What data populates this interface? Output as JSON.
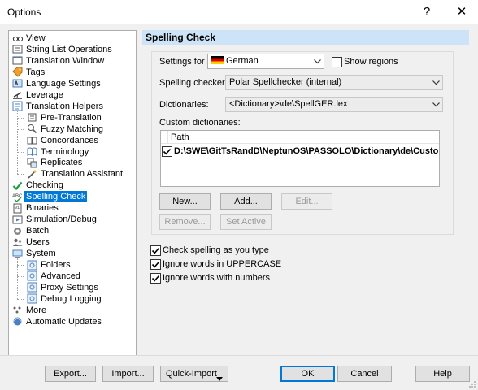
{
  "window": {
    "title": "Options",
    "help_glyph": "?",
    "close_glyph": "✕"
  },
  "tree": {
    "items": [
      {
        "label": "View",
        "icon": "view-icon"
      },
      {
        "label": "String List Operations",
        "icon": "string-list-icon"
      },
      {
        "label": "Translation Window",
        "icon": "translation-window-icon"
      },
      {
        "label": "Tags",
        "icon": "tags-icon"
      },
      {
        "label": "Language Settings",
        "icon": "language-settings-icon"
      },
      {
        "label": "Leverage",
        "icon": "leverage-icon"
      },
      {
        "label": "Translation Helpers",
        "icon": "translation-helpers-icon"
      },
      {
        "label": "Pre-Translation",
        "icon": "pre-translation-icon"
      },
      {
        "label": "Fuzzy Matching",
        "icon": "fuzzy-matching-icon"
      },
      {
        "label": "Concordances",
        "icon": "concordances-icon"
      },
      {
        "label": "Terminology",
        "icon": "terminology-icon"
      },
      {
        "label": "Replicates",
        "icon": "replicates-icon"
      },
      {
        "label": "Translation Assistant",
        "icon": "translation-assistant-icon"
      },
      {
        "label": "Checking",
        "icon": "checkmark-icon"
      },
      {
        "label": "Spelling Check",
        "icon": "spelling-check-icon"
      },
      {
        "label": "Binaries",
        "icon": "binaries-icon"
      },
      {
        "label": "Simulation/Debug",
        "icon": "simulation-icon"
      },
      {
        "label": "Batch",
        "icon": "batch-icon"
      },
      {
        "label": "Users",
        "icon": "users-icon"
      },
      {
        "label": "System",
        "icon": "system-icon"
      },
      {
        "label": "Folders",
        "icon": "folders-icon"
      },
      {
        "label": "Advanced",
        "icon": "advanced-icon"
      },
      {
        "label": "Proxy Settings",
        "icon": "proxy-settings-icon"
      },
      {
        "label": "Debug Logging",
        "icon": "debug-logging-icon"
      },
      {
        "label": "More",
        "icon": "more-icon"
      },
      {
        "label": "Automatic Updates",
        "icon": "automatic-updates-icon"
      }
    ],
    "selected": "Spelling Check"
  },
  "page": {
    "title": "Spelling Check",
    "settings_for_label": "Settings for",
    "settings_for_value": "German",
    "show_regions_label": "Show regions",
    "show_regions_checked": false,
    "spelling_checker_label": "Spelling checker:",
    "spelling_checker_value": "Polar Spellchecker (internal)",
    "dictionaries_label": "Dictionaries:",
    "dictionaries_value": "<Dictionary>\\de\\SpellGER.lex",
    "custom_dictionaries_label": "Custom dictionaries:",
    "custom_list": {
      "header": "Path",
      "rows": [
        {
          "checked": true,
          "path": "D:\\SWE\\GitTsRandD\\NeptunOS\\PASSOLO\\Dictionary\\de\\Custom.dic"
        }
      ]
    },
    "buttons": {
      "new": "New...",
      "add": "Add...",
      "edit": "Edit...",
      "remove": "Remove...",
      "set_active": "Set Active"
    },
    "options": {
      "check_as_you_type": {
        "label": "Check spelling as you type",
        "checked": true
      },
      "ignore_uppercase": {
        "label": "Ignore words in UPPERCASE",
        "checked": true
      },
      "ignore_numbers": {
        "label": "Ignore words with numbers",
        "checked": true
      }
    }
  },
  "footer": {
    "export": "Export...",
    "import": "Import...",
    "quick_import": "Quick-Import",
    "ok": "OK",
    "cancel": "Cancel",
    "help": "Help"
  },
  "colors": {
    "selection": "#0078d7",
    "header_band": "#cde3f8",
    "window_bg": "#f0f0f0"
  }
}
